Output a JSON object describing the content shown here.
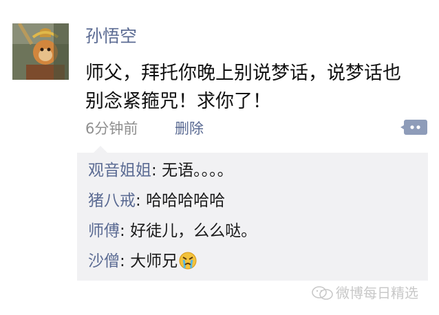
{
  "post": {
    "author": "孙悟空",
    "lines": [
      "师父，拜托你晚上别说梦话，说梦话也",
      "别念紧箍咒！求你了！"
    ],
    "time": "6分钟前",
    "delete_label": "删除"
  },
  "comments": [
    {
      "name": "观音姐姐",
      "sep": ": ",
      "text": "无语。。。。"
    },
    {
      "name": "猪八戒",
      "sep": ": ",
      "text": "哈哈哈哈哈"
    },
    {
      "name": "师傅",
      "sep": ": ",
      "text": "好徒儿，么么哒。"
    },
    {
      "name": "沙僧",
      "sep": ": ",
      "text": "大师兄"
    }
  ],
  "watermark": "微博每日精选",
  "icons": {
    "avatar": "monkey-king-avatar",
    "comment": "comment-bubble-icon",
    "emoji": "angry-tears-emoji-icon",
    "watermark": "wechat-icon"
  },
  "colors": {
    "link": "#5b6b93",
    "comment_bg": "#f1f1f3",
    "meta": "#8f8f8f"
  }
}
